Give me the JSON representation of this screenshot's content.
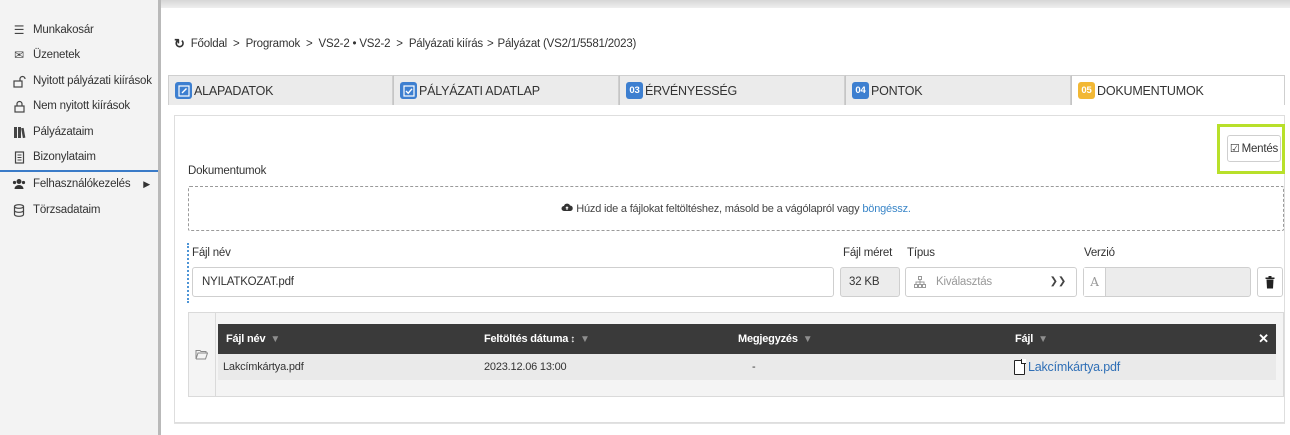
{
  "sidebar": {
    "items": [
      {
        "label": "Munkakosár",
        "icon": "list-icon"
      },
      {
        "label": "Üzenetek",
        "icon": "envelope-icon"
      },
      {
        "label": "Nyitott pályázati kiírások",
        "icon": "unlock-icon"
      },
      {
        "label": "Nem nyitott kiírások",
        "icon": "lock-icon"
      },
      {
        "label": "Pályázataim",
        "icon": "books-icon"
      },
      {
        "label": "Bizonylataim",
        "icon": "document-icon"
      },
      {
        "label": "Felhasználókezelés",
        "icon": "users-icon",
        "has_submenu": true
      },
      {
        "label": "Törzsadataim",
        "icon": "database-icon"
      }
    ]
  },
  "breadcrumb": {
    "items": [
      "Főoldal",
      "Programok",
      "VS2-2 • VS2-2",
      "Pályázati kiírás",
      "Pályázat (VS2/1/5581/2023)"
    ],
    "separator": ">"
  },
  "tabs": [
    {
      "label": "ALAPADATOK",
      "badge": "",
      "icon": "edit-icon",
      "active": false
    },
    {
      "label": "PÁLYÁZATI ADATLAP",
      "badge": "",
      "icon": "checkbox-icon",
      "active": false
    },
    {
      "label": "ÉRVÉNYESSÉG",
      "badge": "03",
      "active": false
    },
    {
      "label": "PONTOK",
      "badge": "04",
      "active": false
    },
    {
      "label": "DOKUMENTUMOK",
      "badge": "05",
      "active": true
    }
  ],
  "toolbar": {
    "save_label": "Mentés"
  },
  "documents": {
    "section_label": "Dokumentumok",
    "dropzone_text": "Húzd ide a fájlokat feltöltéshez, másold be a vágólapról vagy",
    "dropzone_link": "böngéssz."
  },
  "form": {
    "file_name_label": "Fájl név",
    "file_name_value": "NYILATKOZAT.pdf",
    "file_size_label": "Fájl méret",
    "file_size_value": "32 KB",
    "type_label": "Típus",
    "type_placeholder": "Kiválasztás",
    "version_label": "Verzió",
    "version_prefix": "A",
    "version_value": ""
  },
  "file_table": {
    "columns": [
      "Fájl név",
      "Feltöltés dátuma",
      "Megjegyzés",
      "Fájl"
    ],
    "rows": [
      {
        "file_name": "Lakcímkártya.pdf",
        "upload_date": "2023.12.06 13:00",
        "note": "-",
        "file": "Lakcímkártya.pdf"
      }
    ]
  },
  "colors": {
    "accent_blue": "#3d7fd0",
    "active_tab_badge": "#f2b835",
    "highlight_green": "#b8e02a",
    "table_header": "#3a3a3a",
    "link": "#2f6fb6"
  }
}
